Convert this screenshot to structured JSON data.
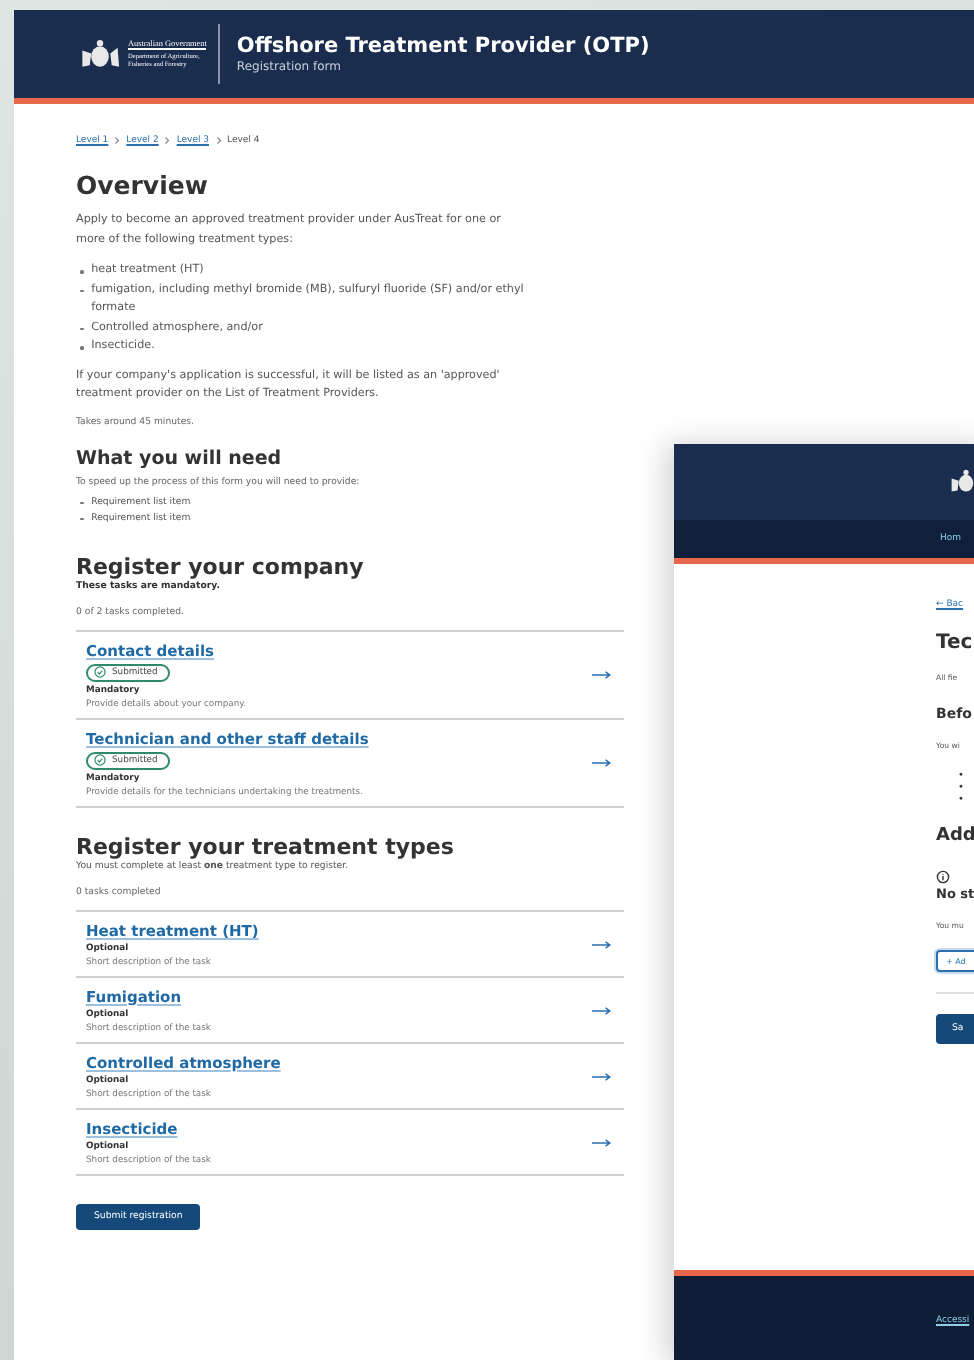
{
  "header": {
    "logo_lines": [
      "Australian Government",
      "Department of Agriculture,",
      "Fisheries and Forestry"
    ],
    "title": "Offshore Treatment Provider (OTP)",
    "subtitle": "Registration form"
  },
  "breadcrumb": [
    {
      "label": "Level 1",
      "current": false
    },
    {
      "label": "Level 2",
      "current": false
    },
    {
      "label": "Level 3",
      "current": false
    },
    {
      "label": "Level 4",
      "current": true
    }
  ],
  "overview": {
    "title": "Overview",
    "intro": "Apply to become an approved treatment provider under AusTreat for one or more of the following treatment types:",
    "bullets": [
      "heat treatment (HT)",
      "fumigation, including methyl bromide (MB), sulfuryl fluoride (SF) and/or ethyl formate",
      "Controlled atmosphere, and/or",
      "Insecticide."
    ],
    "outro": "If your company's application is successful, it will be listed as an 'approved' treatment provider on the List of Treatment Providers.",
    "time": "Takes around 45 minutes."
  },
  "need": {
    "title": "What you will need",
    "intro": "To speed up the process of this form you will need to provide:",
    "items": [
      "Requirement list item",
      "Requirement list item"
    ]
  },
  "company": {
    "title": "Register your company",
    "note": "These tasks are mandatory.",
    "progress": "0 of 2 tasks completed.",
    "tasks": [
      {
        "title": "Contact details",
        "status": "Submitted",
        "requirement": "Mandatory",
        "description": "Provide details about your company."
      },
      {
        "title": "Technician and other staff details",
        "status": "Submitted",
        "requirement": "Mandatory",
        "description": "Provide details for the technicians undertaking the treatments."
      }
    ]
  },
  "treatments": {
    "title": "Register your treatment types",
    "note": "You must complete at least **one** treatment type to register.",
    "progress": "0 tasks completed",
    "tasks": [
      {
        "title": "Heat treatment (HT)",
        "requirement": "Optional",
        "description": "Short description of the task"
      },
      {
        "title": "Fumigation",
        "requirement": "Optional",
        "description": "Short description of the task"
      },
      {
        "title": "Controlled atmosphere",
        "requirement": "Optional",
        "description": "Short description of the task"
      },
      {
        "title": "Insecticide",
        "requirement": "Optional",
        "description": "Short description of the task"
      }
    ]
  },
  "submit_button": "Submit registration",
  "second_page": {
    "nav_link": "Hom",
    "back_link": "← Bac",
    "title": "Tec",
    "fields_note": "All fie",
    "before_title": "Befo",
    "before_text": "You wi",
    "bullet_count_items": [
      "•",
      "•",
      "•"
    ],
    "add_title": "Add",
    "empty_title": "No st",
    "empty_text": "You mu",
    "add_button": "+ Ad",
    "save_button": "Sa",
    "footer_link": "Accessi"
  }
}
